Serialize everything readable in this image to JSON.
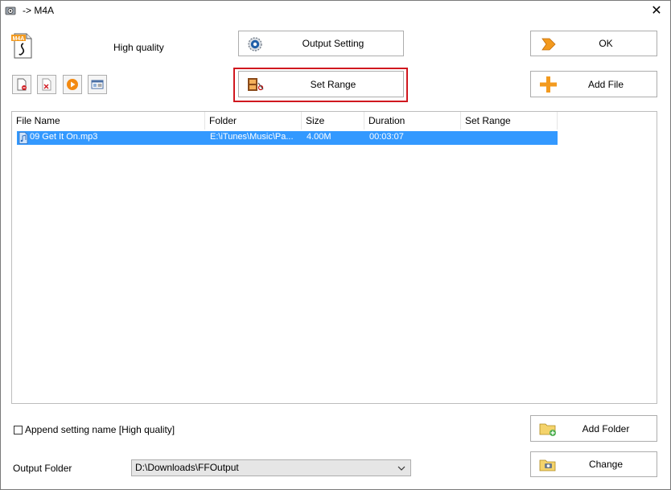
{
  "window": {
    "title": "-> M4A",
    "close_glyph": "✕"
  },
  "format": {
    "icon": "m4a-file-icon",
    "badge": "M4A",
    "quality_label": "High quality"
  },
  "buttons": {
    "output_setting": "Output Setting",
    "ok": "OK",
    "set_range": "Set Range",
    "add_file": "Add File",
    "add_folder": "Add Folder",
    "change": "Change"
  },
  "toolbar": {
    "icons": [
      "remove-file-icon",
      "clear-list-icon",
      "play-icon",
      "media-info-icon"
    ]
  },
  "file_list": {
    "columns": [
      "File Name",
      "Folder",
      "Size",
      "Duration",
      "Set Range"
    ],
    "rows": [
      {
        "file_name": "09 Get It On.mp3",
        "folder": "E:\\iTunes\\Music\\Pa...",
        "size": "4.00M",
        "duration": "00:03:07",
        "set_range": "",
        "selected": true
      }
    ]
  },
  "append_setting": {
    "label": "Append setting name [High quality]",
    "checked": false
  },
  "output_folder": {
    "label": "Output Folder",
    "value": "D:\\Downloads\\FFOutput"
  },
  "colors": {
    "selection": "#3399ff",
    "highlight_border": "#d0181f",
    "accent_orange": "#f39a1e"
  }
}
